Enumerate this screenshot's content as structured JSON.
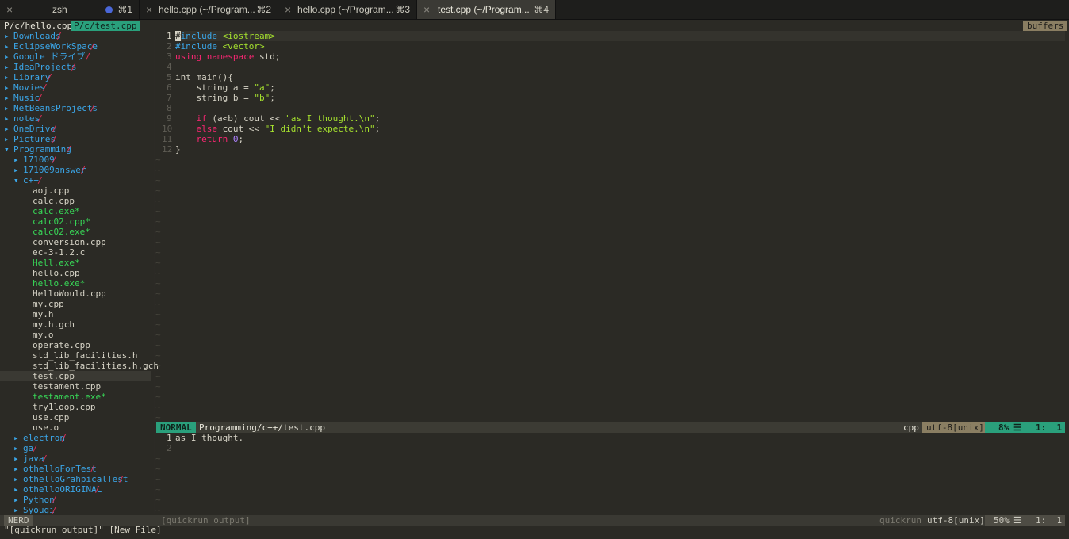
{
  "tabs": [
    {
      "title": "zsh",
      "shortcut": "⌘1",
      "has_dot": true,
      "active": false
    },
    {
      "title": "hello.cpp (~/Program...",
      "shortcut": "⌘2",
      "active": false
    },
    {
      "title": "hello.cpp (~/Program...",
      "shortcut": "⌘3",
      "active": false
    },
    {
      "title": "test.cpp (~/Program...",
      "shortcut": "⌘4",
      "active": true
    }
  ],
  "bufferline": {
    "inactive": "P/c/hello.cpp",
    "active": "P/c/test.cpp",
    "right": "buffers"
  },
  "tree": [
    {
      "d": 0,
      "type": "dir",
      "name": "Downloads",
      "open": false
    },
    {
      "d": 0,
      "type": "dir",
      "name": "EclipseWorkSpace",
      "open": false
    },
    {
      "d": 0,
      "type": "dir",
      "name": "Google ドライブ",
      "open": false
    },
    {
      "d": 0,
      "type": "dir",
      "name": "IdeaProjects",
      "open": false
    },
    {
      "d": 0,
      "type": "dir",
      "name": "Library",
      "open": false
    },
    {
      "d": 0,
      "type": "dir",
      "name": "Movies",
      "open": false
    },
    {
      "d": 0,
      "type": "dir",
      "name": "Music",
      "open": false
    },
    {
      "d": 0,
      "type": "dir",
      "name": "NetBeansProjects",
      "open": false
    },
    {
      "d": 0,
      "type": "dir",
      "name": "notes",
      "open": false
    },
    {
      "d": 0,
      "type": "dir",
      "name": "OneDrive",
      "open": false
    },
    {
      "d": 0,
      "type": "dir",
      "name": "Pictures",
      "open": false
    },
    {
      "d": 0,
      "type": "dir",
      "name": "Programming",
      "open": true
    },
    {
      "d": 1,
      "type": "dir",
      "name": "171009",
      "open": false
    },
    {
      "d": 1,
      "type": "dir",
      "name": "171009answer",
      "open": false
    },
    {
      "d": 1,
      "type": "dir",
      "name": "c++",
      "open": true
    },
    {
      "d": 2,
      "type": "file",
      "name": "aoj.cpp"
    },
    {
      "d": 2,
      "type": "file",
      "name": "calc.cpp"
    },
    {
      "d": 2,
      "type": "exe",
      "name": "calc.exe*"
    },
    {
      "d": 2,
      "type": "exe",
      "name": "calc02.cpp*"
    },
    {
      "d": 2,
      "type": "exe",
      "name": "calc02.exe*"
    },
    {
      "d": 2,
      "type": "file",
      "name": "conversion.cpp"
    },
    {
      "d": 2,
      "type": "file",
      "name": "ec-3-1.2.c"
    },
    {
      "d": 2,
      "type": "exe",
      "name": "Hell.exe*"
    },
    {
      "d": 2,
      "type": "file",
      "name": "hello.cpp"
    },
    {
      "d": 2,
      "type": "exe",
      "name": "hello.exe*"
    },
    {
      "d": 2,
      "type": "file",
      "name": "HelloWould.cpp"
    },
    {
      "d": 2,
      "type": "file",
      "name": "my.cpp"
    },
    {
      "d": 2,
      "type": "file",
      "name": "my.h"
    },
    {
      "d": 2,
      "type": "file",
      "name": "my.h.gch"
    },
    {
      "d": 2,
      "type": "file",
      "name": "my.o"
    },
    {
      "d": 2,
      "type": "file",
      "name": "operate.cpp"
    },
    {
      "d": 2,
      "type": "file",
      "name": "std_lib_facilities.h"
    },
    {
      "d": 2,
      "type": "file",
      "name": "std_lib_facilities.h.gch"
    },
    {
      "d": 2,
      "type": "file",
      "name": "test.cpp",
      "selected": true
    },
    {
      "d": 2,
      "type": "file",
      "name": "testament.cpp"
    },
    {
      "d": 2,
      "type": "exe",
      "name": "testament.exe*"
    },
    {
      "d": 2,
      "type": "file",
      "name": "try1loop.cpp"
    },
    {
      "d": 2,
      "type": "file",
      "name": "use.cpp"
    },
    {
      "d": 2,
      "type": "file",
      "name": "use.o"
    },
    {
      "d": 1,
      "type": "dir",
      "name": "electron",
      "open": false
    },
    {
      "d": 1,
      "type": "dir",
      "name": "ga",
      "open": false
    },
    {
      "d": 1,
      "type": "dir",
      "name": "java",
      "open": false
    },
    {
      "d": 1,
      "type": "dir",
      "name": "othelloForTest",
      "open": false
    },
    {
      "d": 1,
      "type": "dir",
      "name": "othelloGrahpicalTest",
      "open": false
    },
    {
      "d": 1,
      "type": "dir",
      "name": "othelloORIGINAL",
      "open": false
    },
    {
      "d": 1,
      "type": "dir",
      "name": "Python",
      "open": false
    },
    {
      "d": 1,
      "type": "dir",
      "name": "Syougi",
      "open": false
    }
  ],
  "code": [
    [
      [
        "c",
        "#"
      ],
      [
        "i",
        "include "
      ],
      [
        "s",
        "<iostream>"
      ]
    ],
    [
      [
        "i",
        "#include "
      ],
      [
        "s",
        "<vector>"
      ]
    ],
    [
      [
        "p",
        "using "
      ],
      [
        "p",
        "namespace "
      ],
      [
        "t",
        "std;"
      ]
    ],
    [],
    [
      [
        "t",
        "int main(){"
      ]
    ],
    [
      [
        "t",
        "    string a = "
      ],
      [
        "s",
        "\"a\""
      ],
      [
        "t",
        ";"
      ]
    ],
    [
      [
        "t",
        "    string b = "
      ],
      [
        "s",
        "\"b\""
      ],
      [
        "t",
        ";"
      ]
    ],
    [],
    [
      [
        "p",
        "    if "
      ],
      [
        "t",
        "(a<b) cout << "
      ],
      [
        "s",
        "\"as I thought.\\n\""
      ],
      [
        "t",
        ";"
      ]
    ],
    [
      [
        "p",
        "    else "
      ],
      [
        "t",
        "cout << "
      ],
      [
        "s",
        "\"I didn't expecte.\\n\""
      ],
      [
        "t",
        ";"
      ]
    ],
    [
      [
        "p",
        "    return "
      ],
      [
        "n",
        "0"
      ],
      [
        "t",
        ";"
      ]
    ],
    [
      [
        "t",
        "}"
      ]
    ]
  ],
  "status_main": {
    "mode": "NORMAL",
    "file": "Programming/c++/test.cpp",
    "filetype": "cpp",
    "encoding": "utf-8[unix]",
    "percent": "8%",
    "pos": "1:  1"
  },
  "output_lines": [
    "as I thought.",
    ""
  ],
  "status_bottom": {
    "nerd": "NERD",
    "name": "[quickrun output]",
    "filetype": "quickrun",
    "encoding": "utf-8[unix]",
    "percent": "50%",
    "pos": "1:  1"
  },
  "cmdline": "\"[quickrun output]\" [New File]",
  "colors": {
    "dir": "#3ba6e8",
    "slash": "#e0305a",
    "exe": "#38d657",
    "mode_bg": "#2aa07c",
    "accent": "#37c28a"
  }
}
